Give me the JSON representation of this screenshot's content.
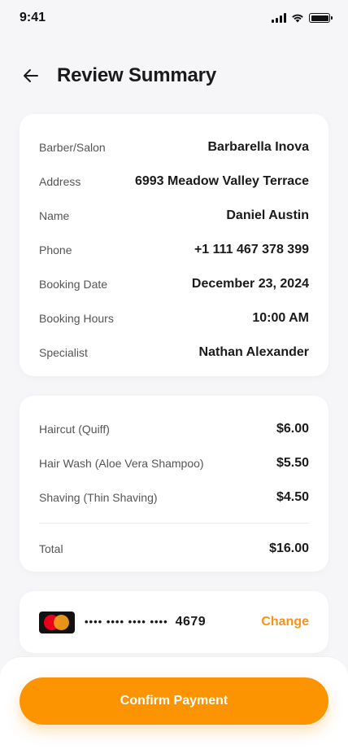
{
  "status_bar": {
    "time": "9:41",
    "icons": [
      "signal-icon",
      "wifi-icon",
      "battery-icon"
    ]
  },
  "header": {
    "back_icon": "arrow-left-icon",
    "title": "Review Summary"
  },
  "details": [
    {
      "label": "Barber/Salon",
      "value": "Barbarella Inova"
    },
    {
      "label": "Address",
      "value": "6993 Meadow Valley Terrace"
    },
    {
      "label": "Name",
      "value": "Daniel Austin"
    },
    {
      "label": "Phone",
      "value": "+1 111 467 378 399"
    },
    {
      "label": "Booking Date",
      "value": "December 23, 2024"
    },
    {
      "label": "Booking Hours",
      "value": "10:00 AM"
    },
    {
      "label": "Specialist",
      "value": "Nathan Alexander"
    }
  ],
  "services": [
    {
      "label": "Haircut (Quiff)",
      "price": "$6.00"
    },
    {
      "label": "Hair Wash (Aloe Vera Shampoo)",
      "price": "$5.50"
    },
    {
      "label": "Shaving (Thin Shaving)",
      "price": "$4.50"
    }
  ],
  "total": {
    "label": "Total",
    "price": "$16.00"
  },
  "payment": {
    "card_icon": "mastercard-icon",
    "masked_dots": "•••• •••• •••• ••••",
    "last_four": "4679",
    "change_label": "Change"
  },
  "confirm_label": "Confirm Payment",
  "colors": {
    "accent": "#fb9400",
    "background": "#f6f6f8",
    "card": "#ffffff"
  }
}
